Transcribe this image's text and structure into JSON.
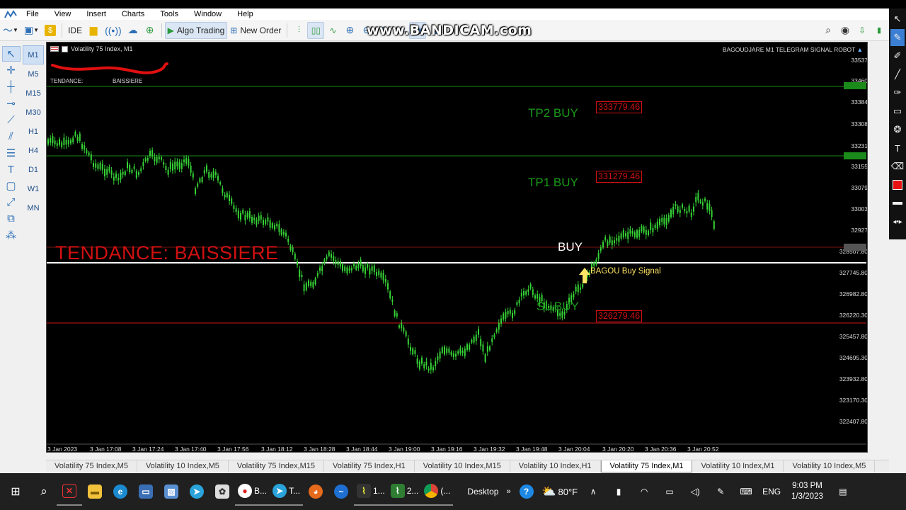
{
  "menu": [
    "File",
    "View",
    "Insert",
    "Charts",
    "Tools",
    "Window",
    "Help"
  ],
  "toolbar": {
    "ide": "IDE",
    "algo_trading": "Algo Trading",
    "new_order": "New Order"
  },
  "watermark": "www.BANDICAM.com",
  "timeframes": [
    "M1",
    "M5",
    "M15",
    "M30",
    "H1",
    "H4",
    "D1",
    "W1",
    "MN"
  ],
  "chart": {
    "title": "Volatility 75 Index, M1",
    "robot": "BAGOUDJARE M1 TELEGRAM SIGNAL ROBOT",
    "trend_label_small": "TENDANCE:",
    "trend_value_small": "BAISSIERE",
    "trend_big": "TENDANCE: BAISSIERE",
    "tp2_label": "TP2 BUY",
    "tp2_price": "333779.46",
    "tp1_label": "TP1 BUY",
    "tp1_price": "331279.46",
    "buy_label": "BUY",
    "signal_label": "BAGOU Buy Signal",
    "sl_label": "SL BUY",
    "sl_price": "326279.46",
    "price_axis": [
      "33537",
      "33460",
      "33384",
      "33308",
      "33231",
      "33155",
      "33079",
      "33003",
      "32927",
      "328507.80",
      "327745.80",
      "326982.80",
      "326220.30",
      "325457.80",
      "324695.30",
      "323932.80",
      "323170.30",
      "322407.80"
    ],
    "time_axis": [
      "3 Jan 2023",
      "3 Jan 17:08",
      "3 Jan 17:24",
      "3 Jan 17:40",
      "3 Jan 17:56",
      "3 Jan 18:12",
      "3 Jan 18:28",
      "3 Jan 18:44",
      "3 Jan 19:00",
      "3 Jan 19:16",
      "3 Jan 19:32",
      "3 Jan 19:48",
      "3 Jan 20:04",
      "3 Jan 20:20",
      "3 Jan 20:36",
      "3 Jan 20:52"
    ],
    "colors": {
      "candles": "#35d335",
      "tp_line": "#1a8a1a",
      "sl_line": "#cc1a1a",
      "entry_line": "#ffffff",
      "trend_text": "#d01010"
    }
  },
  "tabs": [
    "Volatility 75 Index,M5",
    "Volatility 10 Index,M5",
    "Volatility 75 Index,M15",
    "Volatility 75 Index,H1",
    "Volatility 10 Index,M15",
    "Volatility 10 Index,H1",
    "Volatility 75 Index,M1",
    "Volatility 10 Index,M1",
    "Volatility 10 Index,M5"
  ],
  "taskbar": {
    "app_b": "B...",
    "app_t": "T...",
    "app_1": "1...",
    "app_2": "2...",
    "app_paren": "(...",
    "desktop": "Desktop",
    "temp": "80°F",
    "lang": "ENG",
    "time": "9:03 PM",
    "date": "1/3/2023"
  }
}
